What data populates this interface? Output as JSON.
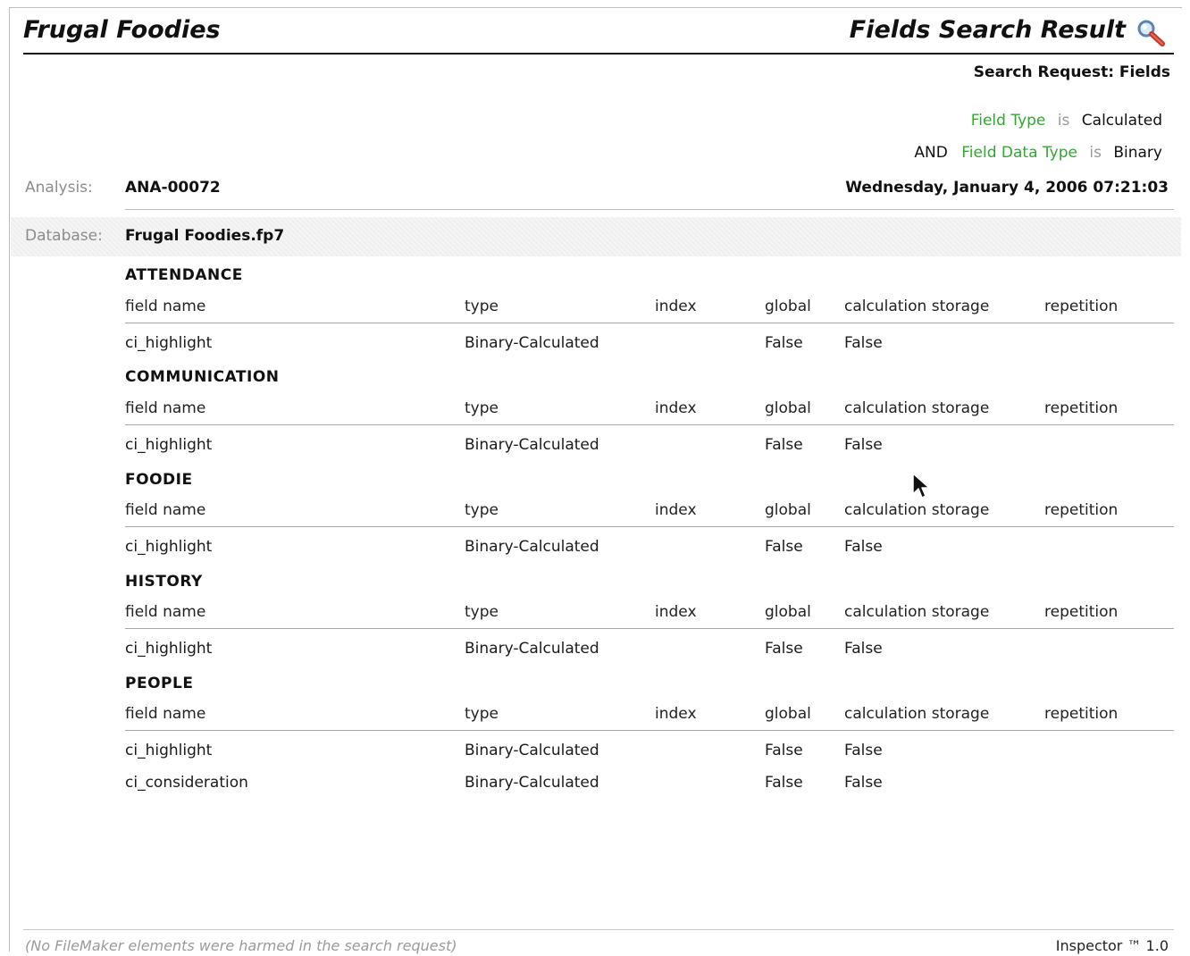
{
  "header": {
    "app_title": "Frugal Foodies",
    "report_title": "Fields Search Result"
  },
  "request": {
    "label": "Search Request: Fields",
    "criteria": [
      {
        "prefix": "",
        "field": "Field Type",
        "op": "is",
        "value": "Calculated"
      },
      {
        "prefix": "AND",
        "field": "Field Data Type",
        "op": "is",
        "value": "Binary"
      }
    ]
  },
  "meta": {
    "analysis_label": "Analysis:",
    "analysis_value": "ANA-00072",
    "date": "Wednesday, January 4, 2006 07:21:03",
    "database_label": "Database:",
    "database_value": "Frugal Foodies.fp7"
  },
  "columns": [
    "field name",
    "type",
    "index",
    "global",
    "calculation storage",
    "repetition"
  ],
  "tables": [
    {
      "name": "ATTENDANCE",
      "rows": [
        {
          "field_name": "ci_highlight",
          "type": "Binary-Calculated",
          "index": "",
          "global": "False",
          "calc_storage": "False",
          "repetition": ""
        }
      ]
    },
    {
      "name": "COMMUNICATION",
      "rows": [
        {
          "field_name": "ci_highlight",
          "type": "Binary-Calculated",
          "index": "",
          "global": "False",
          "calc_storage": "False",
          "repetition": ""
        }
      ]
    },
    {
      "name": "FOODIE",
      "rows": [
        {
          "field_name": "ci_highlight",
          "type": "Binary-Calculated",
          "index": "",
          "global": "False",
          "calc_storage": "False",
          "repetition": ""
        }
      ]
    },
    {
      "name": "HISTORY",
      "rows": [
        {
          "field_name": "ci_highlight",
          "type": "Binary-Calculated",
          "index": "",
          "global": "False",
          "calc_storage": "False",
          "repetition": ""
        }
      ]
    },
    {
      "name": "PEOPLE",
      "rows": [
        {
          "field_name": "ci_highlight",
          "type": "Binary-Calculated",
          "index": "",
          "global": "False",
          "calc_storage": "False",
          "repetition": ""
        },
        {
          "field_name": "ci_consideration",
          "type": "Binary-Calculated",
          "index": "",
          "global": "False",
          "calc_storage": "False",
          "repetition": ""
        }
      ]
    }
  ],
  "footer": {
    "note": "(No FileMaker elements were harmed in the search request)",
    "product": "Inspector ™ 1.0"
  },
  "icons": {
    "title_icon": "magnifier-icon",
    "pointer": "mouse-cursor-icon"
  },
  "colors": {
    "field_green": "#2faa2f",
    "op_grey": "#9a9a9a"
  }
}
